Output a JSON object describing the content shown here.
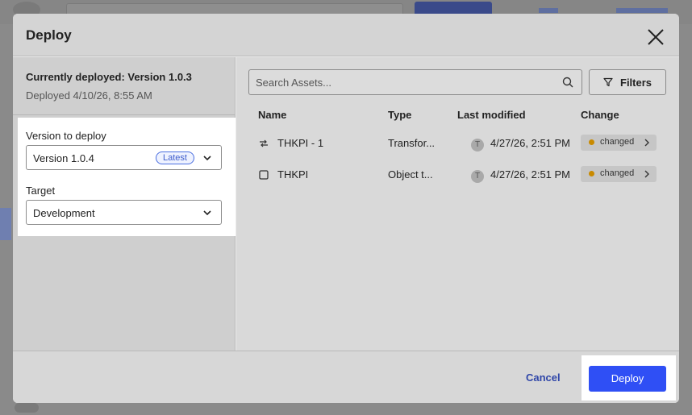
{
  "dialog": {
    "title": "Deploy"
  },
  "current": {
    "title": "Currently deployed: Version 1.0.3",
    "subtitle": "Deployed 4/10/26, 8:55 AM"
  },
  "form": {
    "version_label": "Version to deploy",
    "version_value": "Version 1.0.4",
    "version_badge": "Latest",
    "target_label": "Target",
    "target_value": "Development"
  },
  "search": {
    "placeholder": "Search Assets..."
  },
  "filters": {
    "label": "Filters"
  },
  "table": {
    "headers": [
      "Name",
      "Type",
      "Last modified",
      "Change"
    ],
    "rows": [
      {
        "name": "THKPI - 1",
        "type": "Transfor...",
        "avatar": "T",
        "modified": "4/27/26, 2:51 PM",
        "change": "changed",
        "icon": "transform-icon"
      },
      {
        "name": "THKPI",
        "type": "Object t...",
        "avatar": "T",
        "modified": "4/27/26, 2:51 PM",
        "change": "changed",
        "icon": "object-icon"
      }
    ]
  },
  "footer": {
    "cancel_label": "Cancel",
    "deploy_label": "Deploy"
  },
  "colors": {
    "accent": "#2f4ff5",
    "link": "#2f46a8",
    "changed_dot": "#c98a00"
  }
}
